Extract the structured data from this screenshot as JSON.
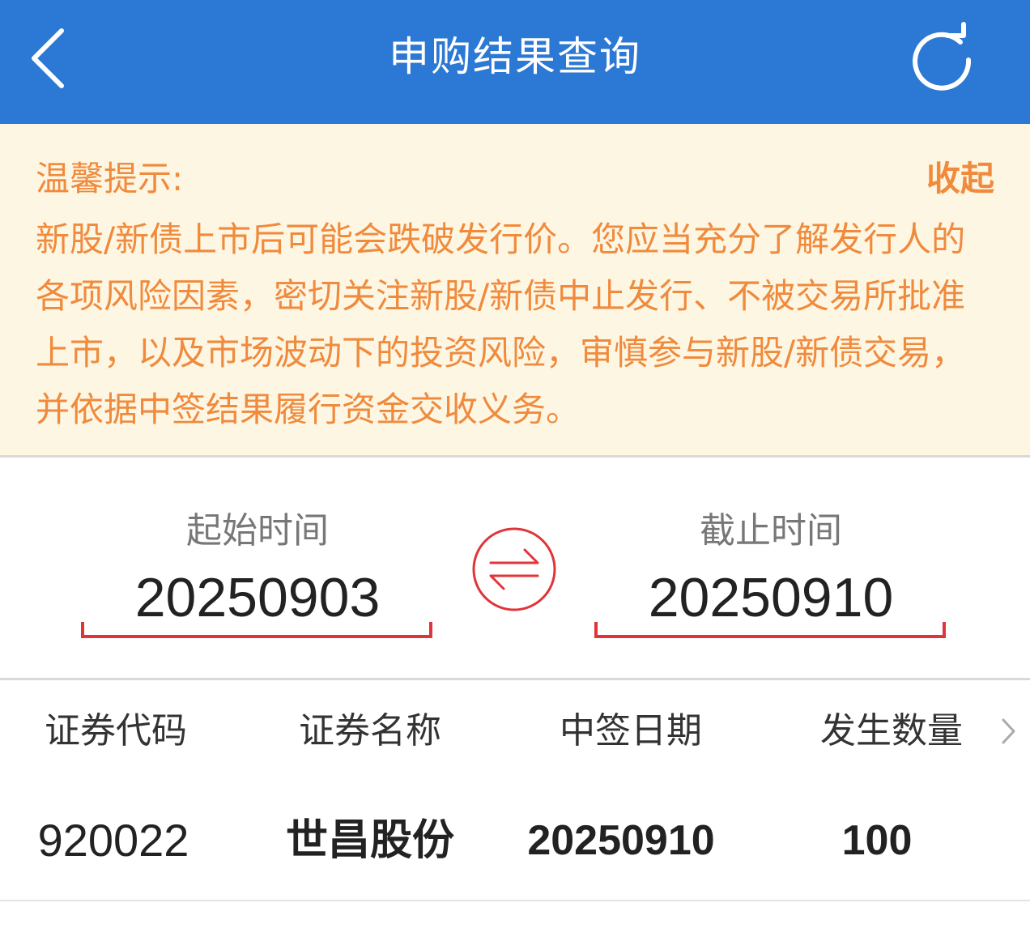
{
  "header": {
    "title": "申购结果查询",
    "back_icon": "chevron-left-icon",
    "refresh_icon": "refresh-icon",
    "background": "#2b78d5"
  },
  "notice": {
    "title": "温馨提示:",
    "collapse_label": "收起",
    "body": "新股/新债上市后可能会跌破发行价。您应当充分了解发行人的各项风险因素，密切关注新股/新债中止发行、不被交易所批准上市，以及市场波动下的投资风险，审慎参与新股/新债交易，并依据中签结果履行资金交收义务。",
    "text_color": "#f08a3c",
    "background": "#fdf6e3"
  },
  "date_range": {
    "start_label": "起始时间",
    "start_value": "20250903",
    "end_label": "截止时间",
    "end_value": "20250910",
    "swap_icon": "swap-arrows-icon",
    "accent": "#e0343a"
  },
  "table": {
    "columns": [
      "证券代码",
      "证券名称",
      "中签日期",
      "发生数量"
    ],
    "more_icon": "chevron-right-icon",
    "rows": [
      {
        "code": "920022",
        "name": "世昌股份",
        "date": "20250910",
        "quantity": "100"
      }
    ]
  }
}
